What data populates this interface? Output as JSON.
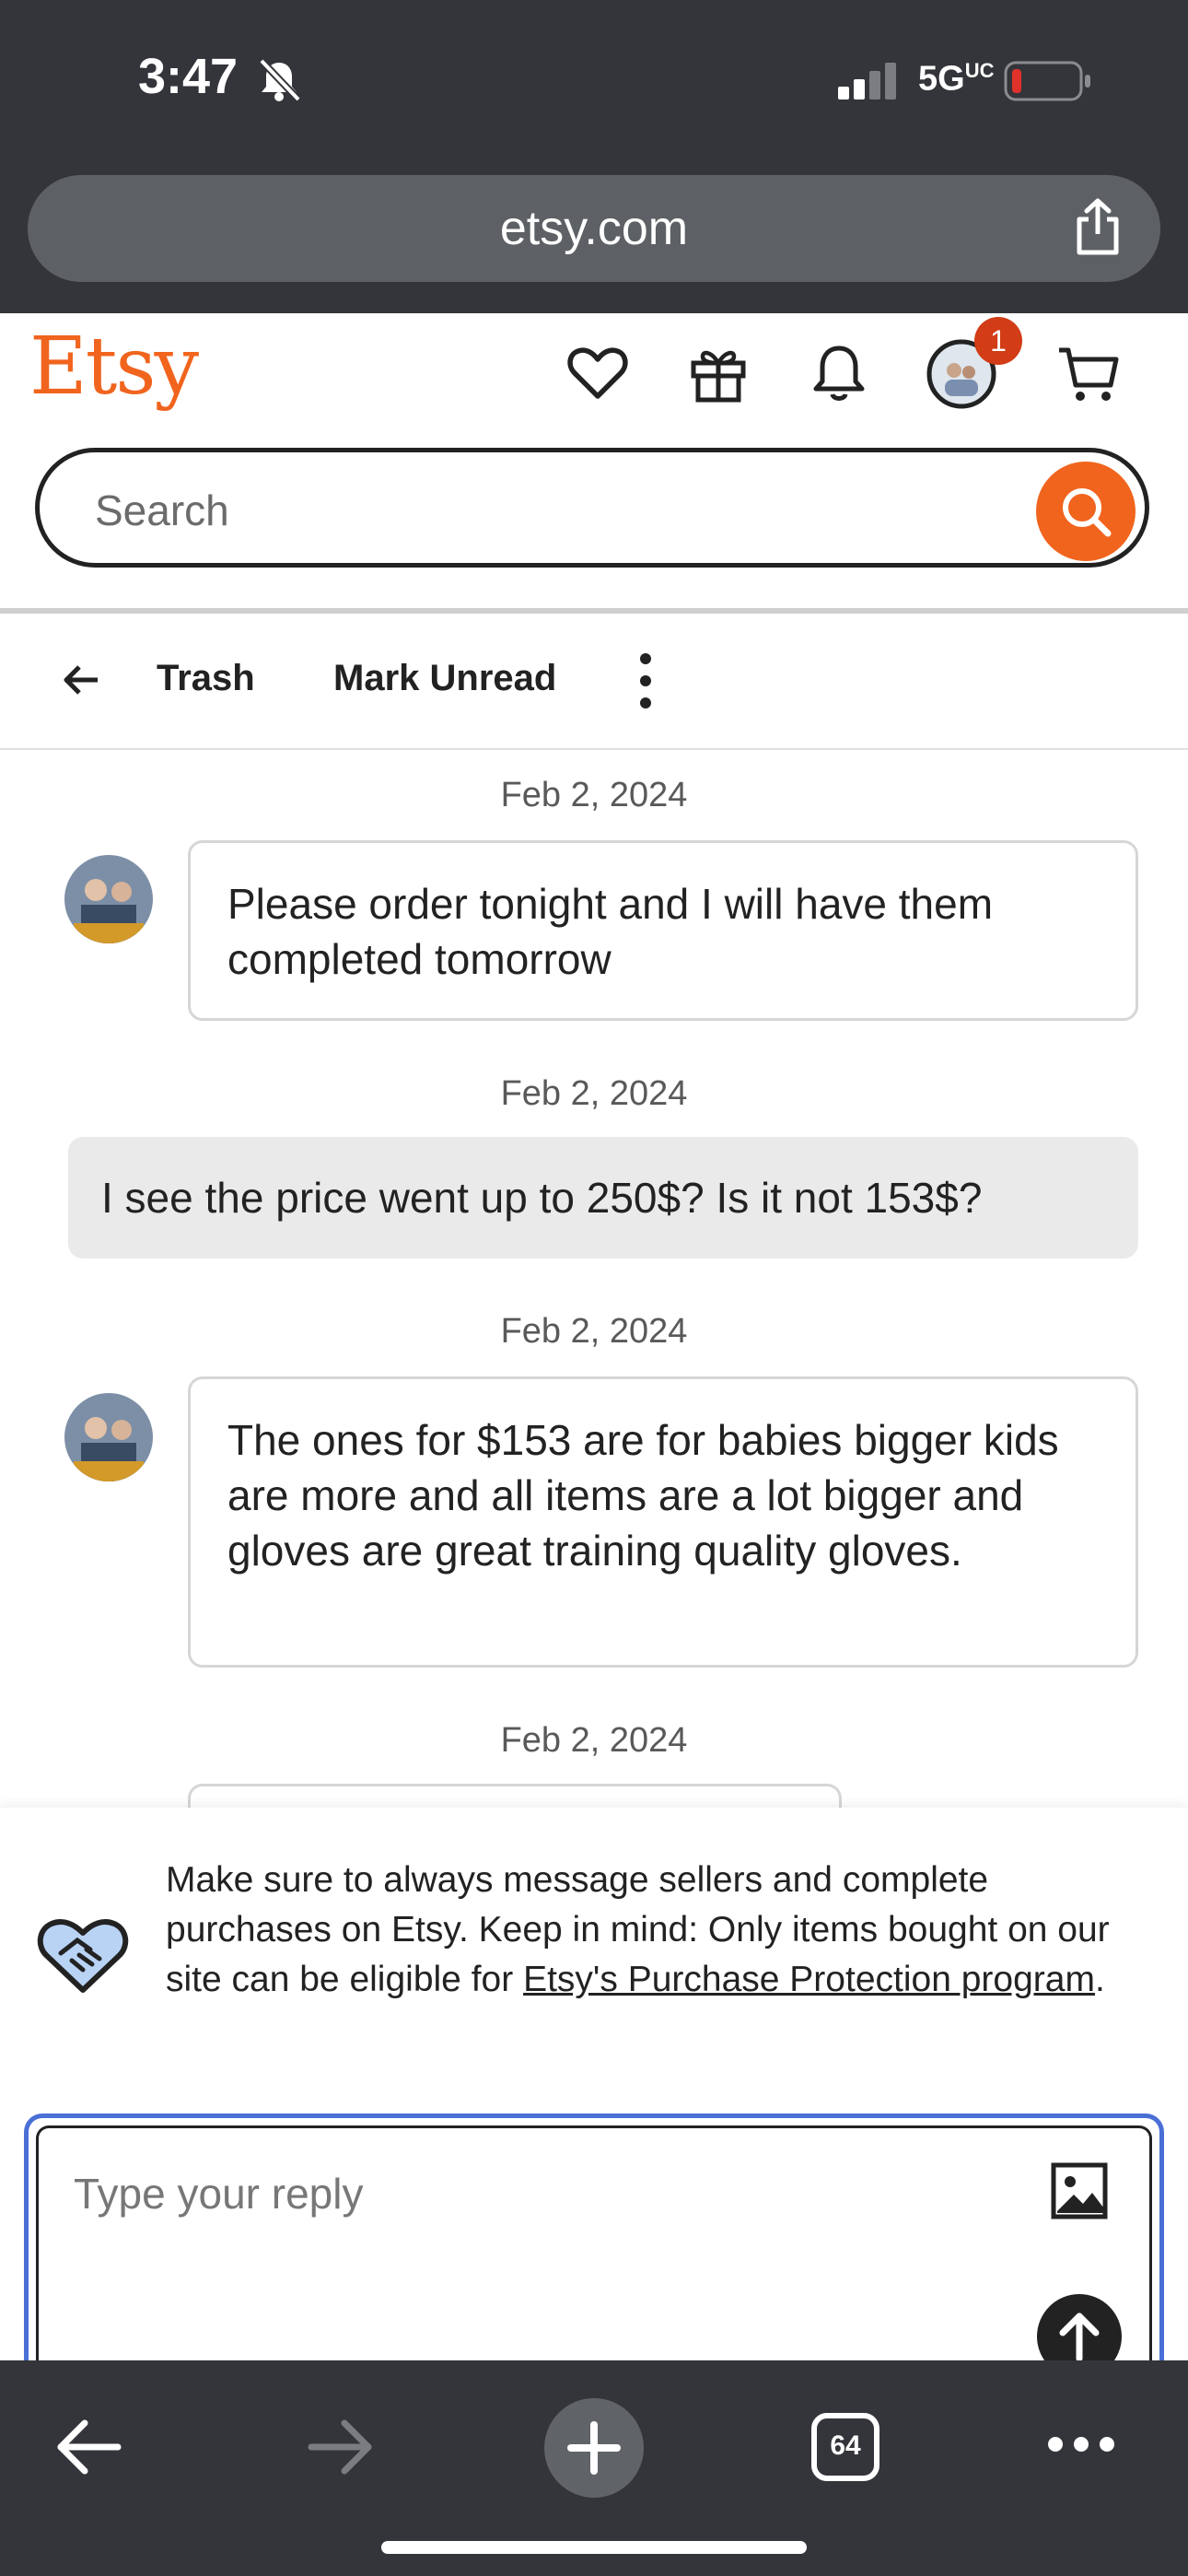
{
  "status_bar": {
    "time": "3:47",
    "network": "5G",
    "network_suffix": "UC",
    "icons": [
      "bell-off-icon",
      "signal-icon",
      "battery-low-icon"
    ]
  },
  "browser": {
    "url": "etsy.com",
    "tab_count": "64",
    "icons": [
      "share-icon",
      "back-icon",
      "forward-icon",
      "new-tab-icon",
      "tabs-icon",
      "more-icon"
    ]
  },
  "header": {
    "logo": "Etsy",
    "notification_count": "1",
    "search_placeholder": "Search",
    "icons": [
      "heart-icon",
      "gift-icon",
      "bell-icon",
      "avatar",
      "cart-icon",
      "search-icon"
    ],
    "brand_color": "#f1641e"
  },
  "toolbar": {
    "trash_label": "Trash",
    "mark_unread_label": "Mark Unread"
  },
  "messages": [
    {
      "date": "Feb 2, 2024",
      "from": "seller",
      "text": "Please order tonight and I will have them completed tomorrow"
    },
    {
      "date": "Feb 2, 2024",
      "from": "buyer",
      "text": "I see the price went up to 250$? Is it not 153$?"
    },
    {
      "date": "Feb 2, 2024",
      "from": "seller",
      "text": "The ones for $153 are for babies bigger kids are more and all items are a lot bigger and gloves are great training quality gloves."
    },
    {
      "date": "Feb 2, 2024",
      "from": "seller",
      "text": ""
    }
  ],
  "notice": {
    "text": "Make sure to always message sellers and complete purchases on Etsy. Keep in mind: Only items bought on our site can be eligible for ",
    "link": "Etsy's Purchase Protection program",
    "suffix": "."
  },
  "reply": {
    "placeholder": "Type your reply"
  }
}
